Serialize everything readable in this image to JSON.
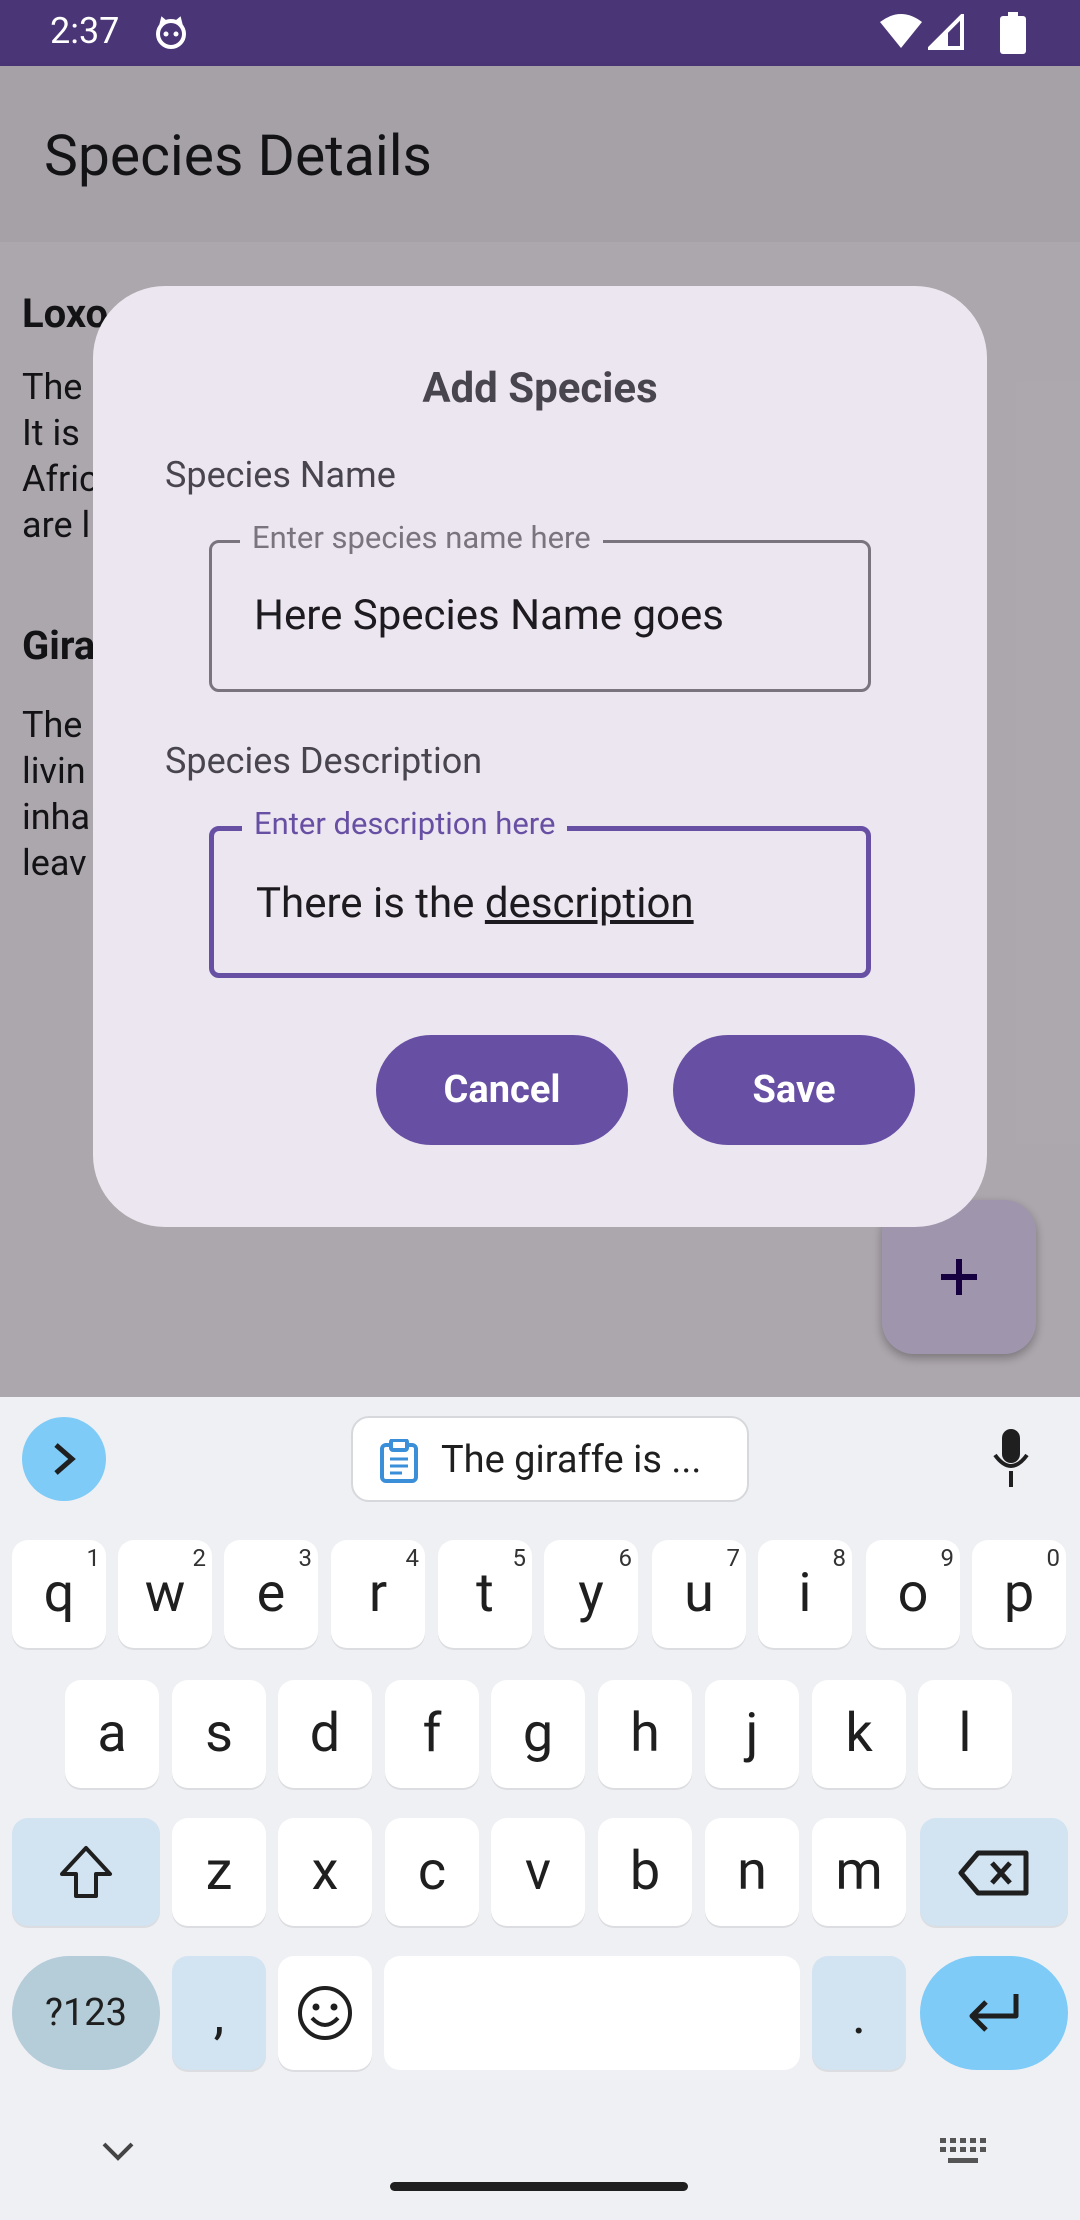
{
  "status_bar": {
    "time": "2:37"
  },
  "app_bar": {
    "title": "Species Details"
  },
  "background_list": [
    {
      "title": "Loxo",
      "text": "The                                                              al.\nIt is                                                            s.\nAfric                                                           ey\nare l"
    },
    {
      "title": "Gira",
      "text": "The\nlivin                                                            s\ninha\nleav"
    }
  ],
  "dialog": {
    "title": "Add Species",
    "name_label": "Species Name",
    "name_placeholder": "Enter species name here",
    "name_value": "Here Species Name goes",
    "desc_label": "Species Description",
    "desc_placeholder": "Enter description here",
    "desc_value_prefix": "There is the ",
    "desc_value_underlined": "description",
    "cancel_label": "Cancel",
    "save_label": "Save"
  },
  "keyboard": {
    "clipboard_suggestion": "The giraffe is ...",
    "row1": [
      {
        "k": "q",
        "h": "1"
      },
      {
        "k": "w",
        "h": "2"
      },
      {
        "k": "e",
        "h": "3"
      },
      {
        "k": "r",
        "h": "4"
      },
      {
        "k": "t",
        "h": "5"
      },
      {
        "k": "y",
        "h": "6"
      },
      {
        "k": "u",
        "h": "7"
      },
      {
        "k": "i",
        "h": "8"
      },
      {
        "k": "o",
        "h": "9"
      },
      {
        "k": "p",
        "h": "0"
      }
    ],
    "row2": [
      "a",
      "s",
      "d",
      "f",
      "g",
      "h",
      "j",
      "k",
      "l"
    ],
    "row3": [
      "z",
      "x",
      "c",
      "v",
      "b",
      "n",
      "m"
    ],
    "symbols_key": "?123",
    "comma_key": ",",
    "period_key": "."
  },
  "colors": {
    "primary": "#6750a4",
    "status_bar": "#4a3577",
    "dialog": "#ece6f0",
    "keyboard_accent": "#7ecbf7"
  }
}
